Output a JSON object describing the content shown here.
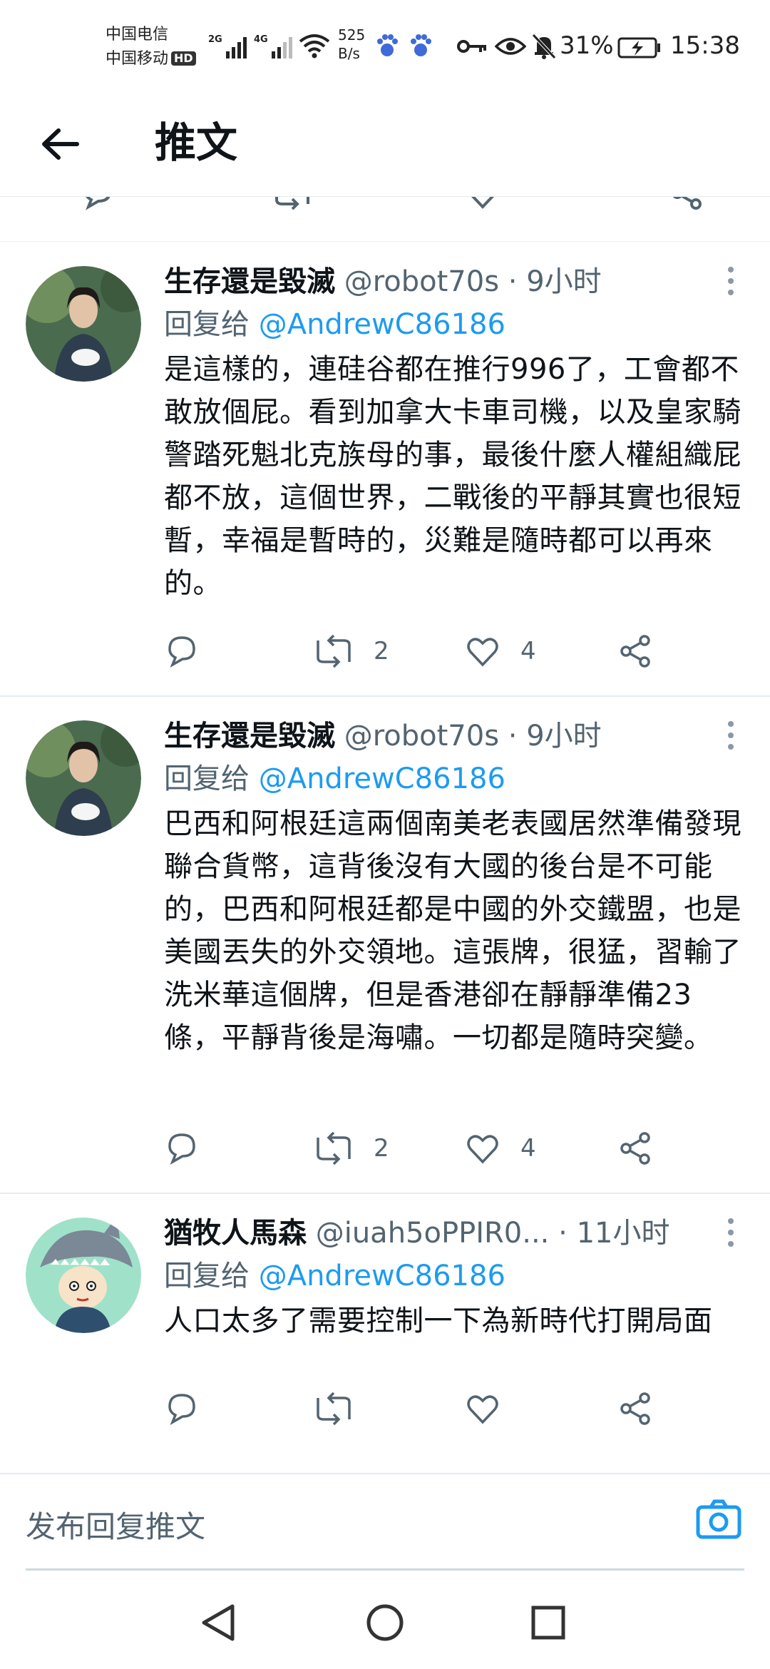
{
  "status_bar": {
    "carrier_1": "中国电信",
    "carrier_2": "中国移动",
    "hd_badge": "HD",
    "signal_1_label": "2G",
    "signal_2_label": "4G",
    "net_speed_value": "525",
    "net_speed_unit": "B/s",
    "battery_percent": "31%",
    "time": "15:38"
  },
  "header": {
    "title": "推文"
  },
  "tweets": [
    {
      "display_name": "生存還是毀滅",
      "handle": "@robot70s",
      "dot": "·",
      "time_ago": "9小时",
      "reply_prefix": "回复给",
      "reply_to": "@AndrewC86186",
      "text": "是這樣的，連硅谷都在推行996了，工會都不敢放個屁。看到加拿大卡車司機，以及皇家騎警踏死魁北克族母的事，最後什麼人權組織屁都不放，這個世界，二戰後的平靜其實也很短暫，幸福是暫時的，災難是隨時都可以再來的。",
      "retweets": "2",
      "likes": "4",
      "avatar": "portrait-photo-with-cat"
    },
    {
      "display_name": "生存還是毀滅",
      "handle": "@robot70s",
      "dot": "·",
      "time_ago": "9小时",
      "reply_prefix": "回复给",
      "reply_to": "@AndrewC86186",
      "text": "巴西和阿根廷這兩個南美老表國居然準備發現聯合貨幣，這背後沒有大國的後台是不可能的，巴西和阿根廷都是中國的外交鐵盟，也是美國丟失的外交領地。這張牌，很猛，習輸了洗米華這個牌，但是香港卻在靜靜準備23條，平靜背後是海嘯。一切都是隨時突變。",
      "retweets": "2",
      "likes": "4",
      "avatar": "portrait-photo-with-cat"
    },
    {
      "display_name": "猶牧人馬森",
      "handle": "@iuah5oPPIR0...",
      "dot": "·",
      "time_ago": "11小时",
      "reply_prefix": "回复给",
      "reply_to": "@AndrewC86186",
      "text": "人口太多了需要控制一下為新時代打開局面",
      "retweets": "",
      "likes": "",
      "avatar": "cartoon-shark-hat-character"
    }
  ],
  "reply_bar": {
    "placeholder": "发布回复推文"
  },
  "colors": {
    "accent": "#1d9bf0",
    "text_primary": "#0f1419",
    "text_secondary": "#536471",
    "divider": "#e6ecf0"
  },
  "icons": {
    "back": "arrow-left-icon",
    "more": "vertical-ellipsis-icon",
    "reply": "speech-bubble-icon",
    "retweet": "retweet-icon",
    "like": "heart-icon",
    "share": "share-icon",
    "camera": "camera-icon",
    "nav_back": "triangle-back-icon",
    "nav_home": "circle-home-icon",
    "nav_recent": "square-recent-icon"
  }
}
